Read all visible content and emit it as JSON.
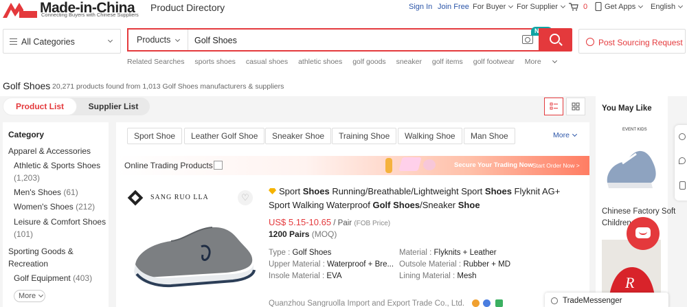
{
  "header": {
    "logo_text": "Made-in-China",
    "logo_sub": "Connecting Buyers with Chinese Suppliers",
    "section": "Product Directory",
    "sign_in": "Sign In",
    "join_free": "Join Free",
    "for_buyer": "For Buyer",
    "for_supplier": "For Supplier",
    "cart_count": "0",
    "get_apps": "Get Apps",
    "language": "English"
  },
  "search": {
    "category": "All Categories",
    "type": "Products",
    "query": "Golf Shoes",
    "new_badge": "NEW",
    "post_sourcing": "Post Sourcing Request",
    "related_label": "Related Searches",
    "related": [
      "sports shoes",
      "casual shoes",
      "athletic shoes",
      "golf goods",
      "sneaker",
      "golf items",
      "golf footwear"
    ],
    "related_more": "More"
  },
  "results": {
    "title": "Golf Shoes",
    "count_text": "20,271 products found from 1,013  Golf Shoes manufacturers & suppliers",
    "tabs": [
      "Product List",
      "Supplier List"
    ]
  },
  "sidebar": {
    "heading": "Category",
    "items": [
      {
        "label": "Apparel & Accessories",
        "count": ""
      },
      {
        "label": "Athletic & Sports Shoes",
        "count": ""
      },
      {
        "label": "",
        "count": "(1,203)"
      },
      {
        "label": "Men's Shoes",
        "count": "(61)"
      },
      {
        "label": "Women's Shoes",
        "count": "(212)"
      },
      {
        "label": "Leisure & Comfort Shoes",
        "count": ""
      },
      {
        "label": "",
        "count": "(101)"
      },
      {
        "label": "Sporting Goods &",
        "count": ""
      },
      {
        "label": "Recreation",
        "count": ""
      },
      {
        "label": "Golf Equipment",
        "count": "(403)"
      }
    ],
    "more": "More"
  },
  "filters": {
    "chips": [
      "Sport Shoe",
      "Leather Golf Shoe",
      "Sneaker Shoe",
      "Training Shoe",
      "Walking Shoe",
      "Man Shoe"
    ],
    "more": "More"
  },
  "trading_bar": {
    "label": "Online Trading Products",
    "secure": "Secure Your Trading Now",
    "start": "Start Order Now >"
  },
  "product": {
    "brand": "SANG RUO LLA",
    "title_parts": [
      {
        "t": "Sport ",
        "b": false
      },
      {
        "t": "Shoes",
        "b": true
      },
      {
        "t": " Running/Breathable/Lightweight Sport ",
        "b": false
      },
      {
        "t": "Shoes",
        "b": true
      },
      {
        "t": " Flyknit AG+ Sport Walking Waterproof ",
        "b": false
      },
      {
        "t": "Golf Shoes",
        "b": true
      },
      {
        "t": "/Sneaker ",
        "b": false
      },
      {
        "t": "Shoe",
        "b": true
      }
    ],
    "price": "US$ 5.15-10.65",
    "unit": " / Pair ",
    "fob": "(FOB Price)",
    "moq_value": "1200 Pairs",
    "moq_label": "(MOQ)",
    "attributes": [
      {
        "k": "Type : ",
        "v": "Golf Shoes"
      },
      {
        "k": "Material : ",
        "v": "Flyknits + Leather"
      },
      {
        "k": "Upper Material : ",
        "v": "Waterproof + Bre..."
      },
      {
        "k": "Outsole Material : ",
        "v": "Rubber + MD"
      },
      {
        "k": "Insole Material : ",
        "v": "EVA"
      },
      {
        "k": "Lining Material : ",
        "v": "Mesh"
      }
    ],
    "company": "Quanzhou Sangruolla Import and Export Trade Co., Ltd."
  },
  "right_panel": {
    "title": "You May Like",
    "item_name": "Chinese Factory Soft Children...",
    "img_label": "EVENT KIDS"
  },
  "chat": {
    "label": "TradeMessenger"
  },
  "colors": {
    "brand_red": "#e4393c",
    "link_blue": "#2b55a8"
  }
}
